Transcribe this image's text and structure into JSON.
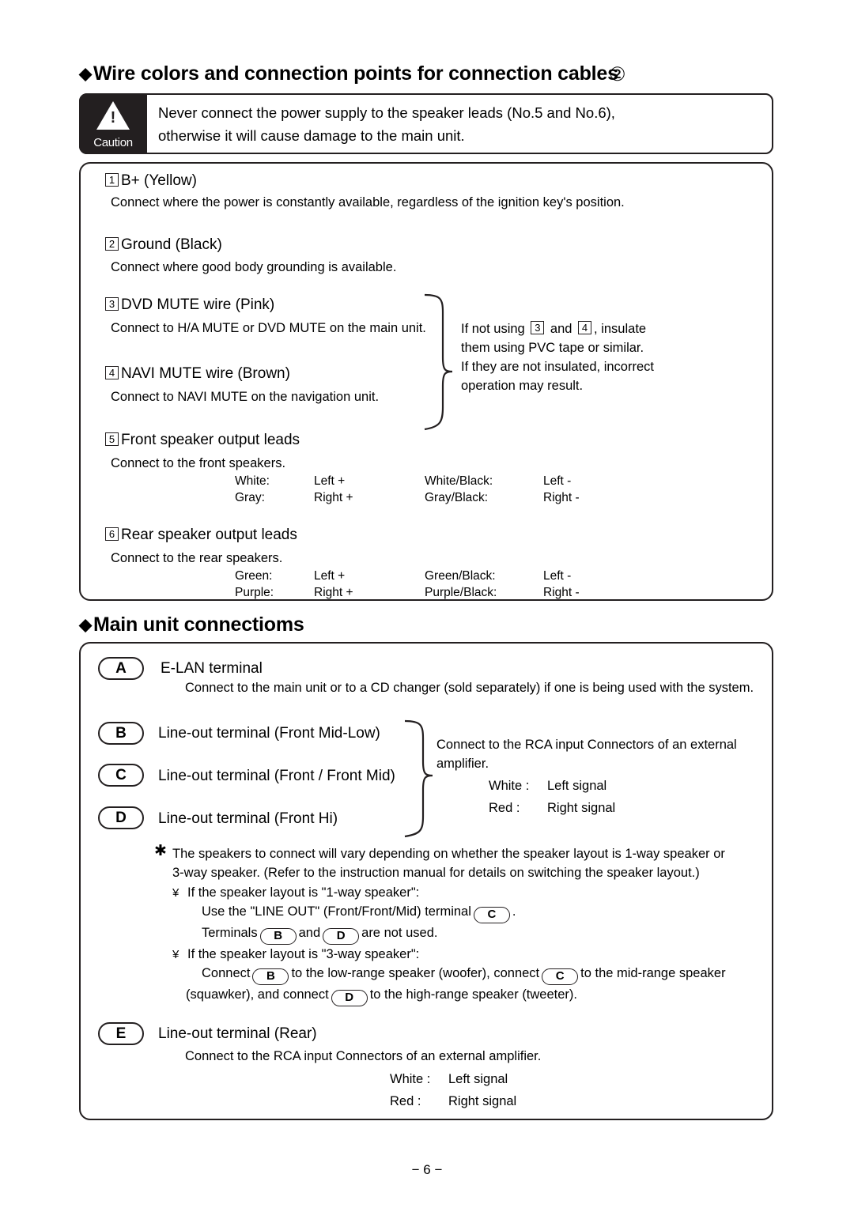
{
  "page": {
    "footer": "− 6 −"
  },
  "heading1": {
    "text": "Wire colors and connection points for connection cables",
    "number": "②"
  },
  "caution": {
    "label": "Caution",
    "line1": "Never connect the power supply to the speaker leads (No.5 and No.6),",
    "line2": "otherwise it will cause damage to the main unit."
  },
  "wires": {
    "items": [
      {
        "num": "1",
        "title": "B+ (Yellow)",
        "body": "Connect where the power is constantly available, regardless of the ignition key's position."
      },
      {
        "num": "2",
        "title": "Ground (Black)",
        "body": "Connect where good body grounding is available."
      },
      {
        "num": "3",
        "title": "DVD MUTE wire (Pink)",
        "body": "Connect to H/A MUTE or DVD MUTE on the main unit."
      },
      {
        "num": "4",
        "title": "NAVI MUTE wire (Brown)",
        "body": "Connect to NAVI MUTE on the navigation unit."
      },
      {
        "num": "5",
        "title": "Front speaker output leads",
        "body": "Connect to the front speakers."
      },
      {
        "num": "6",
        "title": "Rear speaker output leads",
        "body": "Connect to the rear speakers."
      }
    ],
    "insulate_note": {
      "part1": "If not using",
      "part2": "and",
      "part3": ", insulate",
      "line2": "them using PVC tape or similar.",
      "line3": "If they are not insulated, incorrect",
      "line4": "operation may result.",
      "num_a": "3",
      "num_b": "4"
    },
    "front_colors": [
      [
        "White:",
        "Left +",
        "White/Black:",
        "Left -"
      ],
      [
        "Gray:",
        "Right +",
        "Gray/Black:",
        "Right -"
      ]
    ],
    "rear_colors": [
      [
        "Green:",
        "Left +",
        "Green/Black:",
        "Left -"
      ],
      [
        "Purple:",
        "Right +",
        "Purple/Black:",
        "Right -"
      ]
    ]
  },
  "heading2": {
    "text": "Main unit connectioms"
  },
  "main_unit": {
    "terminals": [
      {
        "letter": "A",
        "title": "E-LAN terminal"
      },
      {
        "letter": "B",
        "title": "Line-out terminal  (Front Mid-Low)"
      },
      {
        "letter": "C",
        "title": "Line-out terminal  (Front / Front Mid)"
      },
      {
        "letter": "D",
        "title": "Line-out terminal  (Front Hi)"
      },
      {
        "letter": "E",
        "title": "Line-out terminal  (Rear)"
      }
    ],
    "a_body": "Connect to the main unit or to a CD changer (sold separately) if one is being used with the system.",
    "bcd_note": {
      "line1": "Connect to the RCA  input Connectors of an external",
      "line2": "amplifier.",
      "white_label": "White :",
      "white_value": "Left signal",
      "red_label": "Red :",
      "red_value": "Right signal"
    },
    "star_note": {
      "line1": "The speakers to connect will vary depending on whether the speaker layout is  1-way speaker  or",
      "line2": "3-way speaker. (Refer to the instruction manual for details on switching the speaker layout.)",
      "b1_head": "If the speaker layout is \"1-way speaker\":",
      "b1_line1_pre": "Use the \"LINE OUT\" (Front/Front/Mid) terminal",
      "b1_line1_pill": "C",
      "b1_line1_post": ".",
      "b1_line2_pre": "Terminals",
      "b1_line2_pill1": "B",
      "b1_line2_mid": "and",
      "b1_line2_pill2": "D",
      "b1_line2_post": "are not used.",
      "b2_head": "If the speaker layout is \"3-way speaker\":",
      "b2_line1_pre": "Connect",
      "b2_line1_pill1": "B",
      "b2_line1_mid": "to the low-range speaker (woofer), connect",
      "b2_line1_pill2": "C",
      "b2_line1_post": "to the mid-range speaker",
      "b2_line2_pre": "(squawker), and connect",
      "b2_line2_pill": "D",
      "b2_line2_post": "to the high-range speaker (tweeter)."
    },
    "e_body": {
      "line1": "Connect to the RCA  input Connectors of an external amplifier.",
      "white_label": "White :",
      "white_value": "Left signal",
      "red_label": "Red :",
      "red_value": "Right signal"
    }
  }
}
